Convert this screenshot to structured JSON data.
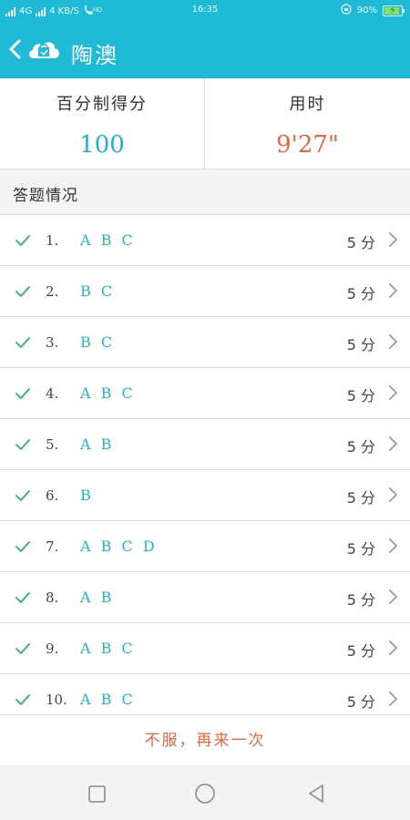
{
  "status_bar": {
    "network": "4G",
    "speed": "4 KB/S",
    "hd": "HD",
    "time": "16:35",
    "battery": "90%",
    "battery_level": 0.9
  },
  "header": {
    "title": "陶澳",
    "back_icon": "back-chevron-icon",
    "logo_icon": "cloud-bag-icon",
    "color": "#1fbad6"
  },
  "stats": {
    "score_label": "百分制得分",
    "score_value": "100",
    "time_label": "用时",
    "time_value": "9'27\""
  },
  "section": {
    "label": "答题情况"
  },
  "answers": [
    {
      "num": "1.",
      "ans": "A B C",
      "pts": "5 分"
    },
    {
      "num": "2.",
      "ans": "B C",
      "pts": "5 分"
    },
    {
      "num": "3.",
      "ans": "B C",
      "pts": "5 分"
    },
    {
      "num": "4.",
      "ans": "A B C",
      "pts": "5 分"
    },
    {
      "num": "5.",
      "ans": "A B",
      "pts": "5 分"
    },
    {
      "num": "6.",
      "ans": "B",
      "pts": "5 分"
    },
    {
      "num": "7.",
      "ans": "A B C D",
      "pts": "5 分"
    },
    {
      "num": "8.",
      "ans": "A B",
      "pts": "5 分"
    },
    {
      "num": "9.",
      "ans": "A B C",
      "pts": "5 分"
    },
    {
      "num": "10.",
      "ans": "A B C",
      "pts": "5 分"
    }
  ],
  "retry_label": "不服，再来一次",
  "colors": {
    "accent": "#1fbad6",
    "correct": "#2fb56a",
    "highlight": "#e8653f"
  }
}
